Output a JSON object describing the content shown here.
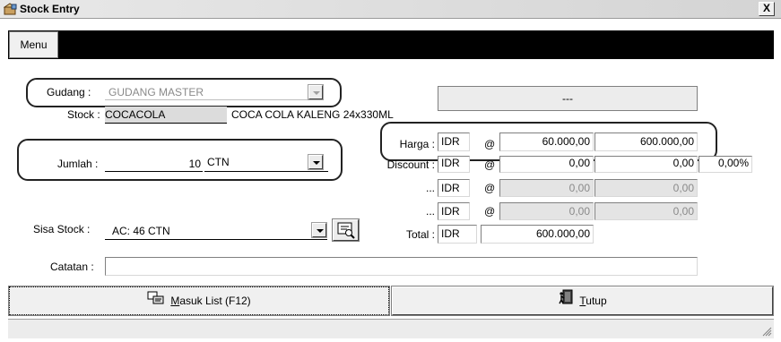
{
  "window": {
    "title": "Stock Entry",
    "close_glyph": "X",
    "icon": "box-icon"
  },
  "menu": {
    "label": "Menu"
  },
  "form": {
    "gudang_label": "Gudang :",
    "gudang_value": "GUDANG MASTER",
    "stock_label": "Stock :",
    "stock_code": "COCACOLA",
    "stock_name": "COCA COLA KALENG 24x330ML",
    "jumlah_label": "Jumlah :",
    "jumlah_value": "10",
    "jumlah_unit": "CTN",
    "sisa_label": "Sisa Stock :",
    "sisa_value": "AC: 46 CTN",
    "catatan_label": "Catatan :",
    "catatan_value": "",
    "info_box": "---"
  },
  "pricing": {
    "harga_label": "Harga :",
    "discount_label": "Discount :",
    "dots_label": "...",
    "total_label": "Total :",
    "currency": "IDR",
    "at": "@",
    "harga_unit": "60.000,00",
    "harga_total": "600.000,00",
    "disc1_unit": "0,00",
    "disc1_total": "0,00",
    "disc1_pct": "0,00%",
    "disc2_unit": "0,00",
    "disc2_total": "0,00",
    "disc3_unit": "0,00",
    "disc3_total": "0,00",
    "total_value": "600.000,00"
  },
  "buttons": {
    "masuk_prefix": "",
    "masuk_accel": "M",
    "masuk_rest": "asuk List (F12)",
    "tutup_accel": "T",
    "tutup_rest": "utup"
  }
}
